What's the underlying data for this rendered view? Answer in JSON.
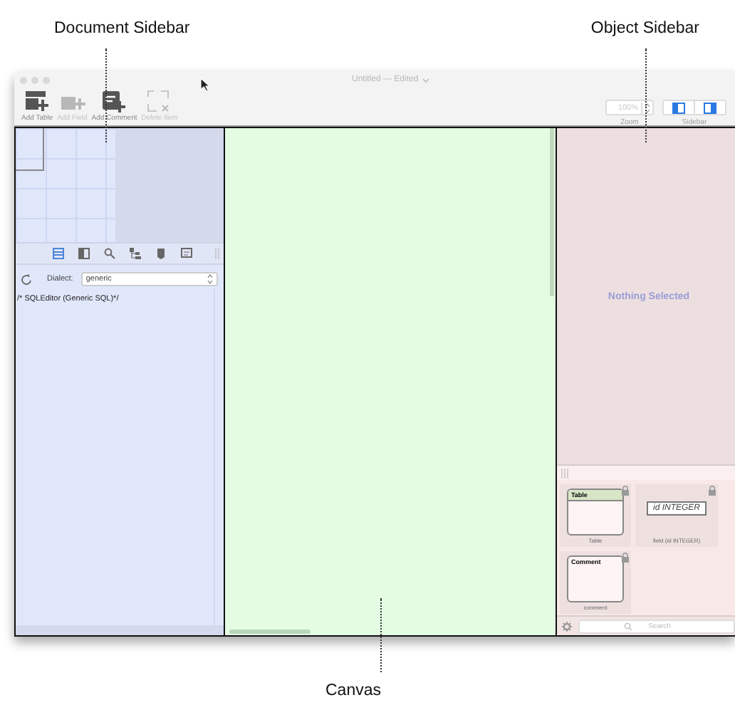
{
  "annotations": [
    {
      "label": "Document Sidebar"
    },
    {
      "label": "Object Sidebar"
    },
    {
      "label": "Canvas"
    }
  ],
  "window": {
    "title": "Untitled — Edited"
  },
  "toolbar": {
    "items": [
      {
        "kind": "add-table",
        "label": "Add Table",
        "disabled": false
      },
      {
        "kind": "add-field",
        "label": "Add Field",
        "disabled": true
      },
      {
        "kind": "add-comment",
        "label": "Add Comment",
        "disabled": false
      },
      {
        "kind": "delete",
        "label": "Delete Item",
        "disabled": true
      }
    ],
    "zoom": {
      "value": "100%",
      "label": "Zoom"
    },
    "sidebar": {
      "label": "Sidebar",
      "buttons": [
        {
          "selected": true
        },
        {
          "selected": true
        }
      ]
    }
  },
  "document_sidebar": {
    "tabs": [
      {
        "kind": "list",
        "selected": true
      },
      {
        "kind": "columns",
        "selected": false
      },
      {
        "kind": "search",
        "selected": false
      },
      {
        "kind": "tree",
        "selected": false
      },
      {
        "kind": "tag",
        "selected": false
      },
      {
        "kind": "doc",
        "selected": false
      }
    ],
    "dialect": {
      "label": "Dialect:",
      "value": "generic"
    },
    "editor_text": "/* SQLEditor (Generic SQL)*/"
  },
  "object_sidebar": {
    "empty_message": "Nothing Selected",
    "library": [
      {
        "kind": "table",
        "title": "Table",
        "caption": "Table"
      },
      {
        "kind": "field",
        "title": "id INTEGER",
        "caption": "field (id INTEGER)"
      },
      {
        "kind": "comment",
        "title": "Comment",
        "caption": "comment"
      }
    ],
    "search": {
      "placeholder": "Search"
    }
  }
}
